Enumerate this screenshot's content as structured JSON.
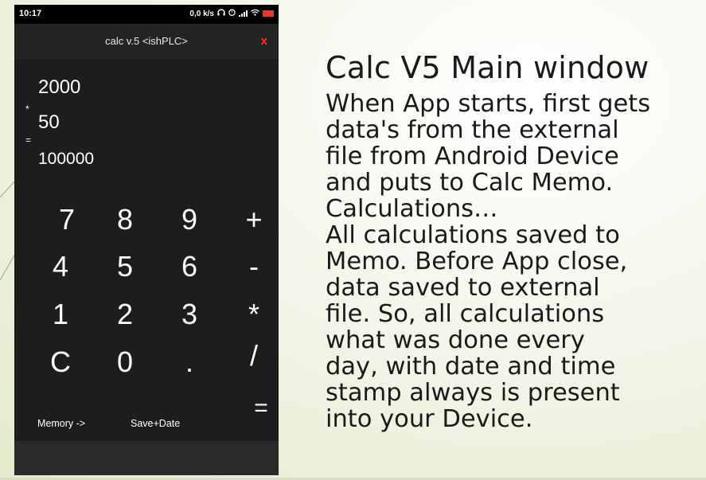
{
  "status_bar": {
    "time": "10:17",
    "network_speed": "0,0 k/s",
    "icons": [
      "headphones-icon",
      "alarm-icon",
      "signal-icon",
      "wifi-icon",
      "battery-icon"
    ],
    "battery_color": "#e53935"
  },
  "app": {
    "title": "calc  v.5 <ishPLC>",
    "close_label": "x",
    "close_color": "#ff2a2a"
  },
  "display": {
    "operand1": "2000",
    "operator": "*",
    "operand2": "50",
    "equals": "=",
    "result": "100000"
  },
  "keypad": {
    "keys": [
      "7",
      "8",
      "9",
      "+",
      "4",
      "5",
      "6",
      "-",
      "1",
      "2",
      "3",
      "*",
      "C",
      "0",
      ".",
      "/"
    ],
    "equals": "="
  },
  "bottom_buttons": {
    "memory": "Memory ->",
    "save_date": "Save+Date"
  },
  "slide": {
    "title": "Calc V5 Main window",
    "body_lines": [
      "When App starts, first gets",
      "data's from the external",
      "file from Android Device",
      "and puts to Calc Memo.",
      "Calculations…",
      "All calculations saved to",
      "Memo. Before App close,",
      "data saved to external",
      "file. So, all calculations",
      "what was done every",
      "day, with date and time",
      "stamp always is present",
      "into your Device."
    ]
  }
}
